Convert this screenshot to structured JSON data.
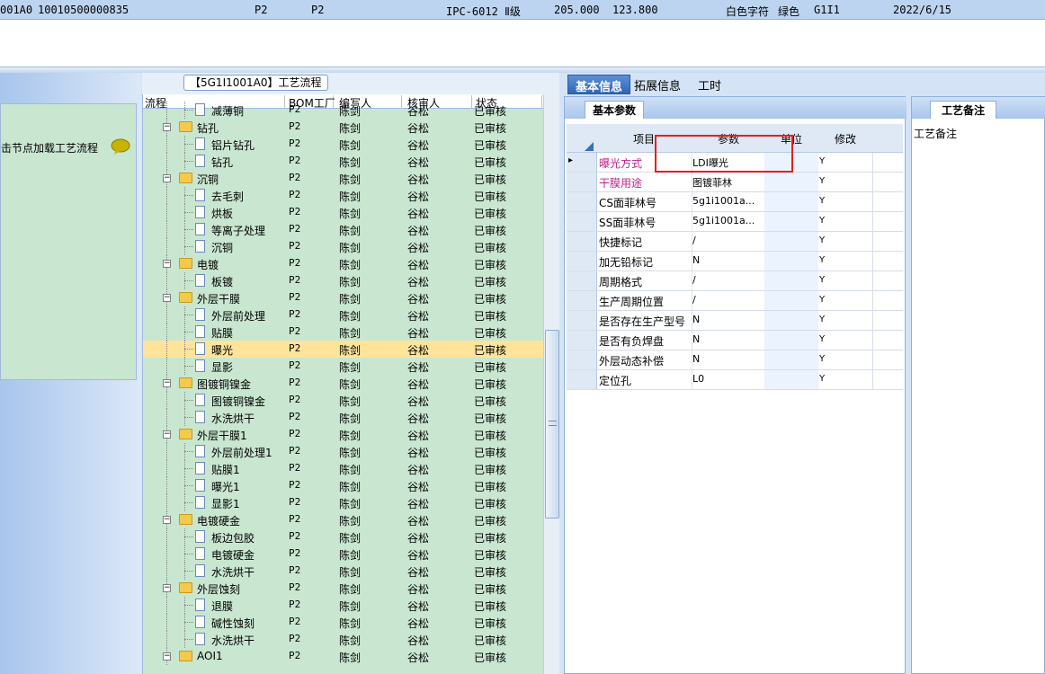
{
  "top_row": {
    "id": "001A0",
    "code": "10010500000835",
    "p1": "P2",
    "p2": "P2",
    "standard": "IPC-6012 Ⅱ级",
    "dim1": "205.000",
    "dim2": "123.800",
    "char": "白色字符",
    "mask": "绿色",
    "g": "G1I1",
    "date": "2022/6/15"
  },
  "left_panel": {
    "hint": "击节点加载工艺流程"
  },
  "middle": {
    "title": "【5G1I1001A0】工艺流程",
    "columns": [
      "流程",
      "BOM工厂",
      "编写人",
      "核审人",
      "状态"
    ],
    "rows": [
      {
        "level": 2,
        "name": "减薄铜",
        "type": "doc",
        "bom": "P2",
        "writer": "陈剑",
        "reviewer": "谷松",
        "status": "已审核"
      },
      {
        "level": 1,
        "name": "钻孔",
        "type": "folder",
        "bom": "P2",
        "writer": "陈剑",
        "reviewer": "谷松",
        "status": "已审核"
      },
      {
        "level": 2,
        "name": "铝片钻孔",
        "type": "doc",
        "bom": "P2",
        "writer": "陈剑",
        "reviewer": "谷松",
        "status": "已审核"
      },
      {
        "level": 2,
        "name": "钻孔",
        "type": "doc",
        "bom": "P2",
        "writer": "陈剑",
        "reviewer": "谷松",
        "status": "已审核"
      },
      {
        "level": 1,
        "name": "沉铜",
        "type": "folder",
        "bom": "P2",
        "writer": "陈剑",
        "reviewer": "谷松",
        "status": "已审核"
      },
      {
        "level": 2,
        "name": "去毛刺",
        "type": "doc",
        "bom": "P2",
        "writer": "陈剑",
        "reviewer": "谷松",
        "status": "已审核"
      },
      {
        "level": 2,
        "name": "烘板",
        "type": "doc",
        "bom": "P2",
        "writer": "陈剑",
        "reviewer": "谷松",
        "status": "已审核"
      },
      {
        "level": 2,
        "name": "等离子处理",
        "type": "doc",
        "bom": "P2",
        "writer": "陈剑",
        "reviewer": "谷松",
        "status": "已审核"
      },
      {
        "level": 2,
        "name": "沉铜",
        "type": "doc",
        "bom": "P2",
        "writer": "陈剑",
        "reviewer": "谷松",
        "status": "已审核"
      },
      {
        "level": 1,
        "name": "电镀",
        "type": "folder",
        "bom": "P2",
        "writer": "陈剑",
        "reviewer": "谷松",
        "status": "已审核"
      },
      {
        "level": 2,
        "name": "板镀",
        "type": "doc",
        "bom": "P2",
        "writer": "陈剑",
        "reviewer": "谷松",
        "status": "已审核"
      },
      {
        "level": 1,
        "name": "外层干膜",
        "type": "folder",
        "bom": "P2",
        "writer": "陈剑",
        "reviewer": "谷松",
        "status": "已审核"
      },
      {
        "level": 2,
        "name": "外层前处理",
        "type": "doc",
        "bom": "P2",
        "writer": "陈剑",
        "reviewer": "谷松",
        "status": "已审核"
      },
      {
        "level": 2,
        "name": "贴膜",
        "type": "doc",
        "bom": "P2",
        "writer": "陈剑",
        "reviewer": "谷松",
        "status": "已审核"
      },
      {
        "level": 2,
        "name": "曝光",
        "type": "doc",
        "bom": "P2",
        "writer": "陈剑",
        "reviewer": "谷松",
        "status": "已审核",
        "selected": true
      },
      {
        "level": 2,
        "name": "显影",
        "type": "doc",
        "bom": "P2",
        "writer": "陈剑",
        "reviewer": "谷松",
        "status": "已审核"
      },
      {
        "level": 1,
        "name": "图镀铜镍金",
        "type": "folder",
        "bom": "P2",
        "writer": "陈剑",
        "reviewer": "谷松",
        "status": "已审核"
      },
      {
        "level": 2,
        "name": "图镀铜镍金",
        "type": "doc",
        "bom": "P2",
        "writer": "陈剑",
        "reviewer": "谷松",
        "status": "已审核"
      },
      {
        "level": 2,
        "name": "水洗烘干",
        "type": "doc",
        "bom": "P2",
        "writer": "陈剑",
        "reviewer": "谷松",
        "status": "已审核"
      },
      {
        "level": 1,
        "name": "外层干膜1",
        "type": "folder",
        "bom": "P2",
        "writer": "陈剑",
        "reviewer": "谷松",
        "status": "已审核"
      },
      {
        "level": 2,
        "name": "外层前处理1",
        "type": "doc",
        "bom": "P2",
        "writer": "陈剑",
        "reviewer": "谷松",
        "status": "已审核"
      },
      {
        "level": 2,
        "name": "贴膜1",
        "type": "doc",
        "bom": "P2",
        "writer": "陈剑",
        "reviewer": "谷松",
        "status": "已审核"
      },
      {
        "level": 2,
        "name": "曝光1",
        "type": "doc",
        "bom": "P2",
        "writer": "陈剑",
        "reviewer": "谷松",
        "status": "已审核"
      },
      {
        "level": 2,
        "name": "显影1",
        "type": "doc",
        "bom": "P2",
        "writer": "陈剑",
        "reviewer": "谷松",
        "status": "已审核"
      },
      {
        "level": 1,
        "name": "电镀硬金",
        "type": "folder",
        "bom": "P2",
        "writer": "陈剑",
        "reviewer": "谷松",
        "status": "已审核"
      },
      {
        "level": 2,
        "name": "板边包胶",
        "type": "doc",
        "bom": "P2",
        "writer": "陈剑",
        "reviewer": "谷松",
        "status": "已审核"
      },
      {
        "level": 2,
        "name": "电镀硬金",
        "type": "doc",
        "bom": "P2",
        "writer": "陈剑",
        "reviewer": "谷松",
        "status": "已审核"
      },
      {
        "level": 2,
        "name": "水洗烘干",
        "type": "doc",
        "bom": "P2",
        "writer": "陈剑",
        "reviewer": "谷松",
        "status": "已审核"
      },
      {
        "level": 1,
        "name": "外层蚀刻",
        "type": "folder",
        "bom": "P2",
        "writer": "陈剑",
        "reviewer": "谷松",
        "status": "已审核"
      },
      {
        "level": 2,
        "name": "退膜",
        "type": "doc",
        "bom": "P2",
        "writer": "陈剑",
        "reviewer": "谷松",
        "status": "已审核"
      },
      {
        "level": 2,
        "name": "碱性蚀刻",
        "type": "doc",
        "bom": "P2",
        "writer": "陈剑",
        "reviewer": "谷松",
        "status": "已审核"
      },
      {
        "level": 2,
        "name": "水洗烘干",
        "type": "doc",
        "bom": "P2",
        "writer": "陈剑",
        "reviewer": "谷松",
        "status": "已审核"
      },
      {
        "level": 1,
        "name": "AOI1",
        "type": "folder",
        "bom": "P2",
        "writer": "陈剑",
        "reviewer": "谷松",
        "status": "已审核"
      }
    ]
  },
  "right": {
    "tabs": [
      "基本信息",
      "拓展信息",
      "工时"
    ],
    "active_tab": "基本信息",
    "info_tab": "基本参数",
    "param_columns": [
      "项目",
      "参数",
      "单位",
      "修改"
    ],
    "params": [
      {
        "key": "曝光方式",
        "value": "LDI曝光",
        "modify": "Y",
        "pink": true,
        "current": true
      },
      {
        "key": "干膜用途",
        "value": "图镀菲林",
        "modify": "Y",
        "pink": true
      },
      {
        "key": "CS面菲林号",
        "value": "5g1i1001a...",
        "modify": "Y"
      },
      {
        "key": "SS面菲林号",
        "value": "5g1i1001a...",
        "modify": "Y"
      },
      {
        "key": "快捷标记",
        "value": "/",
        "modify": "Y"
      },
      {
        "key": "加无铅标记",
        "value": "N",
        "modify": "Y"
      },
      {
        "key": "周期格式",
        "value": "/",
        "modify": "Y"
      },
      {
        "key": "生产周期位置",
        "value": "/",
        "modify": "Y"
      },
      {
        "key": "是否存在生产型号",
        "value": "N",
        "modify": "Y"
      },
      {
        "key": "是否有负焊盘",
        "value": "N",
        "modify": "Y"
      },
      {
        "key": "外层动态补偿",
        "value": "N",
        "modify": "Y"
      },
      {
        "key": "定位孔",
        "value": "L0",
        "modify": "Y"
      }
    ],
    "note_tab": "工艺备注",
    "note_label": "工艺备注"
  },
  "colors": {
    "grid_bg": "#c9e6d0",
    "selected_row": "#fde49a",
    "tab_active": "#3a70c0",
    "highlight_box": "#e02020",
    "pink_text": "#c0208e"
  }
}
